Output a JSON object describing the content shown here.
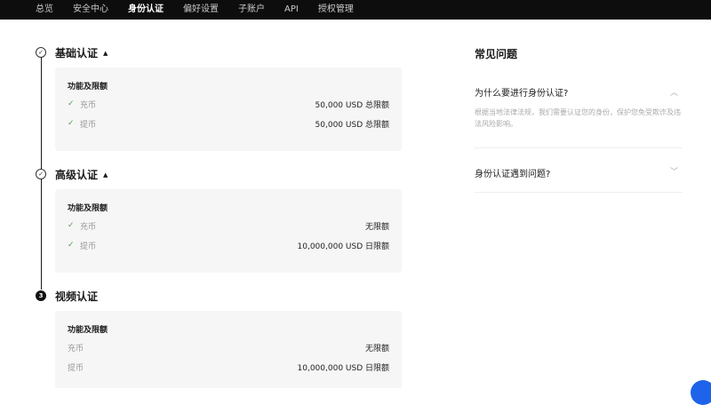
{
  "nav": {
    "items": [
      {
        "label": "总览",
        "active": false
      },
      {
        "label": "安全中心",
        "active": false
      },
      {
        "label": "身份认证",
        "active": true
      },
      {
        "label": "偏好设置",
        "active": false
      },
      {
        "label": "子账户",
        "active": false
      },
      {
        "label": "API",
        "active": false
      },
      {
        "label": "授权管理",
        "active": false
      }
    ]
  },
  "steps": [
    {
      "title": "基础认证",
      "status": "completed",
      "expanded": true,
      "card_title": "功能及限额",
      "rows": [
        {
          "label": "充币",
          "value": "50,000 USD 总限额",
          "checked": true
        },
        {
          "label": "提币",
          "value": "50,000 USD 总限额",
          "checked": true
        }
      ]
    },
    {
      "title": "高级认证",
      "status": "completed",
      "expanded": true,
      "card_title": "功能及限额",
      "rows": [
        {
          "label": "充币",
          "value": "无限额",
          "checked": true
        },
        {
          "label": "提币",
          "value": "10,000,000 USD 日限额",
          "checked": true
        }
      ]
    },
    {
      "title": "视频认证",
      "status": "pending",
      "number": "3",
      "card_title": "功能及限额",
      "rows": [
        {
          "label": "充币",
          "value": "无限额",
          "checked": false
        },
        {
          "label": "提币",
          "value": "10,000,000 USD 日限额",
          "checked": false
        }
      ]
    }
  ],
  "faq": {
    "title": "常见问题",
    "items": [
      {
        "question": "为什么要进行身份认证?",
        "answer": "根据当地法律法规，我们需要认证您的身份，保护您免受欺诈及违法风险影响。",
        "expanded": true
      },
      {
        "question": "身份认证遇到问题?",
        "expanded": false
      }
    ]
  },
  "colors": {
    "nav_bg": "#0d0d0d",
    "check": "#5a9a5a",
    "card_bg": "#f6f6f6",
    "float_button": "#1e63e9"
  }
}
